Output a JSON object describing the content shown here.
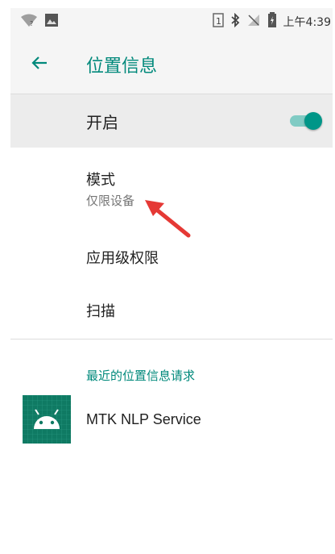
{
  "status_bar": {
    "left_icons": [
      "wifi-question-icon",
      "image-notification-icon"
    ],
    "right_icons": [
      "sim-1-icon",
      "bluetooth-icon",
      "no-signal-icon",
      "battery-icon"
    ],
    "time": "上午4:39"
  },
  "app_bar": {
    "back_icon": "arrow-left-icon",
    "title": "位置信息"
  },
  "master_switch": {
    "label": "开启",
    "state": "on"
  },
  "settings": {
    "mode": {
      "title": "模式",
      "subtitle": "仅限设备"
    },
    "app_permissions": {
      "label": "应用级权限"
    },
    "scanning": {
      "label": "扫描"
    }
  },
  "recent_requests": {
    "header": "最近的位置信息请求",
    "items": [
      {
        "label": "MTK NLP Service",
        "icon": "android-app-icon"
      }
    ]
  },
  "colors": {
    "accent": "#00897b",
    "switch_thumb": "#009688",
    "switch_track": "#80cbc4",
    "annotation_arrow": "#e53935"
  }
}
